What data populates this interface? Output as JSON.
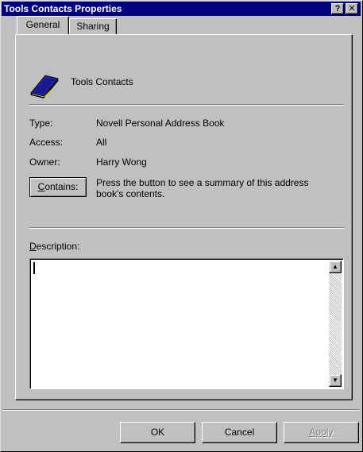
{
  "window": {
    "title": "Tools Contacts Properties",
    "help_glyph": "?",
    "close_glyph": "✕"
  },
  "tabs": [
    {
      "label": "General",
      "selected": true
    },
    {
      "label": "Sharing",
      "selected": false
    }
  ],
  "general": {
    "book_name": "Tools Contacts",
    "type_label": "Type:",
    "type_value": "Novell Personal Address Book",
    "access_label": "Access:",
    "access_value": "All",
    "owner_label": "Owner:",
    "owner_value": "Harry Wong",
    "contains_hotkey": "C",
    "contains_rest": "ontains:",
    "contains_hint_line1": "Press the button to see a summary of this address",
    "contains_hint_line2": "book's contents.",
    "description_hotkey": "D",
    "description_rest": "escription:",
    "description_value": ""
  },
  "buttons": {
    "ok": "OK",
    "cancel": "Cancel",
    "apply": "Apply"
  },
  "icons": {
    "book": "address-book-icon"
  }
}
